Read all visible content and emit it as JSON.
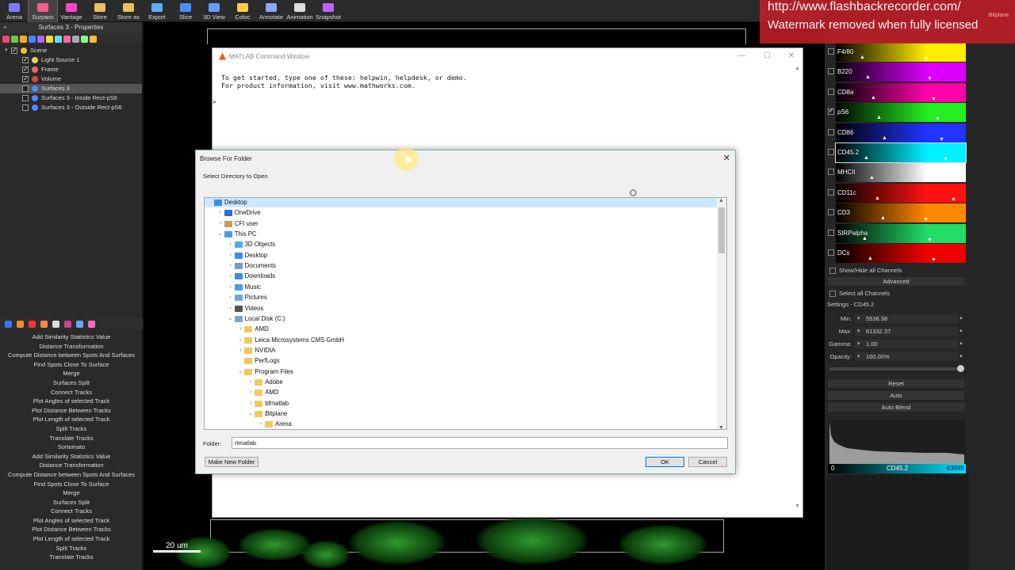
{
  "toolbar": {
    "buttons": [
      {
        "label": "Arena",
        "color": "#7a7aff"
      },
      {
        "label": "Surpass",
        "color": "#ff5a8a"
      },
      {
        "label": "Vantage",
        "color": "#ff44cc"
      },
      {
        "label": "Store",
        "color": "#e8c060"
      },
      {
        "label": "Store as",
        "color": "#e8c060"
      },
      {
        "label": "Export",
        "color": "#5ab0ff"
      },
      {
        "label": "Slice",
        "color": "#4a90ff"
      },
      {
        "label": "3D View",
        "color": "#6a9aff"
      },
      {
        "label": "Coloc",
        "color": "#ffcc44"
      },
      {
        "label": "Annotate",
        "color": "#88aaff"
      },
      {
        "label": "Animation",
        "color": "#ddd"
      },
      {
        "label": "Snapshot",
        "color": "#bb66ff"
      }
    ],
    "active": "Surpass"
  },
  "left_panel": {
    "title": "Surfaces 3 - Properties",
    "scene_tree": [
      {
        "label": "Scene",
        "checked": true,
        "level": 0,
        "color": "#e8c040"
      },
      {
        "label": "Light Source 1",
        "checked": true,
        "level": 1,
        "color": "#e8d060"
      },
      {
        "label": "Frame",
        "checked": true,
        "level": 1,
        "color": "#ee6666"
      },
      {
        "label": "Volume",
        "checked": true,
        "level": 1,
        "color": "#dd4444"
      },
      {
        "label": "Surfaces 3",
        "checked": false,
        "level": 1,
        "color": "#5588ff",
        "selected": true
      },
      {
        "label": "Surfaces 3 - Inside Rect-pS6",
        "checked": false,
        "level": 1,
        "color": "#5588ff"
      },
      {
        "label": "Surfaces 3 - Outside Rect-pS6",
        "checked": false,
        "level": 1,
        "color": "#5588ff"
      }
    ],
    "xtensions": [
      "Add Similarity Statistics Value",
      "Distance Transformation",
      "Compute Distance between Spots And Surfaces",
      "Find Spots Close To Surface",
      "Merge",
      "Surfaces Split",
      "Connect Tracks",
      "Plot Angles of selected Track",
      "Plot Distance Between Tracks",
      "Plot Length of selected Track",
      "Split Tracks",
      "Translate Tracks",
      "Sortomato",
      "Add Similarity Statistics Value",
      "Distance Transformation",
      "Compute Distance between Spots And Surfaces",
      "Find Spots Close To Surface",
      "Merge",
      "Surfaces Split",
      "Connect Tracks",
      "Plot Angles of selected Track",
      "Plot Distance Between Tracks",
      "Plot Length of selected Track",
      "Split Tracks",
      "Translate Tracks"
    ]
  },
  "view3d": {
    "scale_label": "20 um"
  },
  "watermark": {
    "line1": "http://www.flashbackrecorder.com/",
    "line2": "Watermark removed when fully licensed",
    "small": "Bitplane"
  },
  "channels": [
    {
      "name": "F4/80",
      "color": "#ffee00",
      "checked": false
    },
    {
      "name": "B220",
      "color": "#dd00ff",
      "checked": false
    },
    {
      "name": "CD8a",
      "color": "#ff00aa",
      "checked": false
    },
    {
      "name": "pS6",
      "color": "#22ee22",
      "checked": true
    },
    {
      "name": "CD86",
      "color": "#2233ff",
      "checked": false
    },
    {
      "name": "CD45.2",
      "color": "#00f0ff",
      "checked": false,
      "highlight": true
    },
    {
      "name": "MHCII",
      "color": "#ffffff",
      "checked": false
    },
    {
      "name": "CD11c",
      "color": "#ff1111",
      "checked": false
    },
    {
      "name": "CD3",
      "color": "#ff8800",
      "checked": false
    },
    {
      "name": "SIRPalpha",
      "color": "#22dd66",
      "checked": false
    },
    {
      "name": "DCs",
      "color": "#ee0000",
      "checked": false
    }
  ],
  "right_panel": {
    "show_hide_all": "Show/Hide all Channels",
    "advanced": "Advanced",
    "select_all": "Select all Channels",
    "settings_title": "Settings - CD45.2",
    "min_label": "Min:",
    "min_value": "5538.38",
    "max_label": "Max:",
    "max_value": "61332.37",
    "gamma_label": "Gamma:",
    "gamma_value": "1.00",
    "opacity_label": "Opacity:",
    "opacity_value": "100.00%",
    "reset": "Reset",
    "auto": "Auto",
    "auto_blend": "Auto Blend",
    "histo_min": "0",
    "histo_channel": "CD45.2",
    "histo_max": "63999"
  },
  "matlab": {
    "title": "MATLAB Command Window",
    "console_line1": "To get started, type one of these: helpwin, helpdesk, or demo.",
    "console_line2": "For product information, visit www.mathworks.com.",
    "prompt": "»"
  },
  "dialog": {
    "title": "Browse For Folder",
    "subtitle": "Select Directory to Open",
    "tree": [
      {
        "label": "Desktop",
        "level": 0,
        "exp": "",
        "color": "#3a8ee6",
        "selected": true
      },
      {
        "label": "OneDrive",
        "level": 1,
        "exp": "›",
        "color": "#2a6fd6"
      },
      {
        "label": "CFI user",
        "level": 1,
        "exp": "›",
        "color": "#c99a60"
      },
      {
        "label": "This PC",
        "level": 1,
        "exp": "⌄",
        "color": "#4a9ae6"
      },
      {
        "label": "3D Objects",
        "level": 2,
        "exp": "›",
        "color": "#4ab0e6"
      },
      {
        "label": "Desktop",
        "level": 2,
        "exp": "›",
        "color": "#3a8ee6"
      },
      {
        "label": "Documents",
        "level": 2,
        "exp": "›",
        "color": "#7a9ac0"
      },
      {
        "label": "Downloads",
        "level": 2,
        "exp": "›",
        "color": "#3a8ee6"
      },
      {
        "label": "Music",
        "level": 2,
        "exp": "›",
        "color": "#4a9ae6"
      },
      {
        "label": "Pictures",
        "level": 2,
        "exp": "›",
        "color": "#6aaad0"
      },
      {
        "label": "Videos",
        "level": 2,
        "exp": "›",
        "color": "#555"
      },
      {
        "label": "Local Disk (C:)",
        "level": 2,
        "exp": "⌄",
        "color": "#8aa0b8"
      },
      {
        "label": "AMD",
        "level": 3,
        "exp": "›",
        "color": "#f0c860"
      },
      {
        "label": "Leica Microsystems CMS GmbH",
        "level": 3,
        "exp": "›",
        "color": "#f0c860"
      },
      {
        "label": "NVIDIA",
        "level": 3,
        "exp": "›",
        "color": "#f0c860"
      },
      {
        "label": "PerfLogs",
        "level": 3,
        "exp": "",
        "color": "#f0c860"
      },
      {
        "label": "Program Files",
        "level": 3,
        "exp": "⌄",
        "color": "#f0c860"
      },
      {
        "label": "Adobe",
        "level": 4,
        "exp": "›",
        "color": "#f0c860"
      },
      {
        "label": "AMD",
        "level": 4,
        "exp": "›",
        "color": "#f0c860"
      },
      {
        "label": "bfmatlab",
        "level": 4,
        "exp": "›",
        "color": "#f0c860"
      },
      {
        "label": "Bitplane",
        "level": 4,
        "exp": "⌄",
        "color": "#f0c860"
      },
      {
        "label": "Arena",
        "level": 5,
        "exp": "›",
        "color": "#f0c860"
      }
    ],
    "folder_label": "Folder:",
    "folder_value": "rtmatlab",
    "make_new_folder": "Make New Folder",
    "ok": "OK",
    "cancel": "Cancel"
  }
}
